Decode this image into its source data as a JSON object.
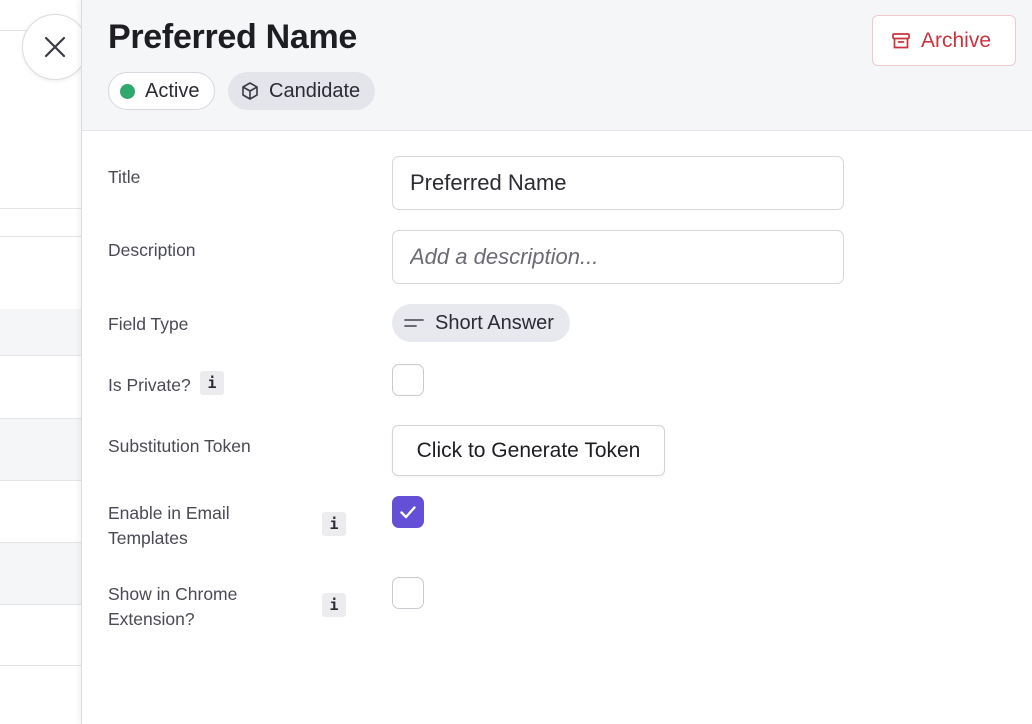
{
  "header": {
    "title": "Preferred Name",
    "status_badge": "Active",
    "entity_badge": "Candidate",
    "archive_label": "Archive",
    "colors": {
      "status_dot": "#2ea86c",
      "archive": "#c9353d",
      "check": "#6450d6"
    }
  },
  "form": {
    "title_label": "Title",
    "title_value": "Preferred Name",
    "description_label": "Description",
    "description_placeholder": "Add a description...",
    "field_type_label": "Field Type",
    "field_type_value": "Short Answer",
    "is_private_label": "Is Private?",
    "is_private_checked": false,
    "token_label": "Substitution Token",
    "token_button": "Click to Generate Token",
    "email_templates_label": "Enable in Email Templates",
    "email_templates_checked": true,
    "chrome_label": "Show in Chrome Extension?",
    "chrome_checked": false,
    "info_glyph": "i"
  },
  "icons": {
    "close": "close-icon",
    "archive": "archive-box-icon",
    "candidate": "cube-icon",
    "short_answer": "short-text-icon",
    "check": "checkmark-icon",
    "info": "info-icon"
  }
}
